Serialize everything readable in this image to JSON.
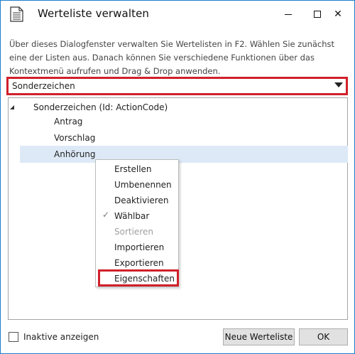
{
  "window": {
    "title": "Werteliste verwalten",
    "accent": "#1a7fd0",
    "highlight_color": "#d0202a"
  },
  "titlebar": {
    "icon": "document-icon",
    "minimize": "minimize-icon",
    "maximize": "maximize-icon",
    "close_label": "✕"
  },
  "description": "Über dieses Dialogfenster verwalten Sie Wertelisten in F2. Wählen Sie zunächst eine der Listen aus. Danach können Sie verschiedene Funktionen über das Kontextmenü aufrufen und Drag & Drop anwenden.",
  "dropdown": {
    "selected": "Sonderzeichen"
  },
  "tree": {
    "root": "Sonderzeichen (Id: ActionCode)",
    "items": [
      "Antrag",
      "Vorschlag",
      "Anhörung"
    ],
    "selected_index": 2
  },
  "context_menu": {
    "items": [
      {
        "label": "Erstellen",
        "enabled": true,
        "checked": false
      },
      {
        "label": "Umbenennen",
        "enabled": true,
        "checked": false
      },
      {
        "label": "Deaktivieren",
        "enabled": true,
        "checked": false
      },
      {
        "label": "Wählbar",
        "enabled": true,
        "checked": true
      },
      {
        "label": "Sortieren",
        "enabled": false,
        "checked": false
      },
      {
        "label": "Importieren",
        "enabled": true,
        "checked": false
      },
      {
        "label": "Exportieren",
        "enabled": true,
        "checked": false
      },
      {
        "label": "Eigenschaften",
        "enabled": true,
        "checked": false
      }
    ],
    "check_glyph": "✓"
  },
  "footer": {
    "checkbox_label": "Inaktive anzeigen",
    "checkbox_checked": false,
    "new_button": "Neue Werteliste",
    "ok_button": "OK"
  }
}
